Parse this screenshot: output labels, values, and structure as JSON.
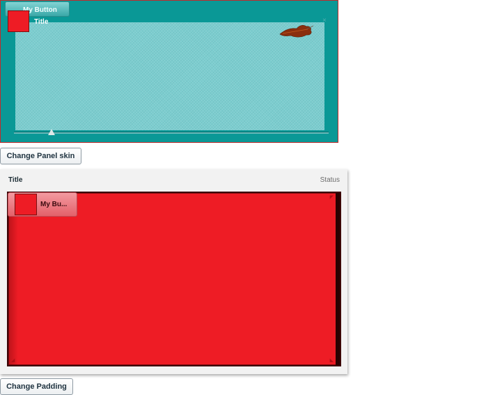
{
  "panel_one": {
    "button_label": "My Button",
    "title": "Title",
    "close_glyph": "×",
    "slider_value": 0.12,
    "swatch_color": "#ee1c25",
    "background_color": "#0a9896"
  },
  "change_skin_button": {
    "label": "Change Panel skin"
  },
  "panel_two": {
    "title": "Title",
    "status": "Status",
    "button_label": "My Bu...",
    "swatch_color": "#ee1c25",
    "content_color": "#ee1c25"
  },
  "change_padding_button": {
    "label": "Change Padding"
  }
}
